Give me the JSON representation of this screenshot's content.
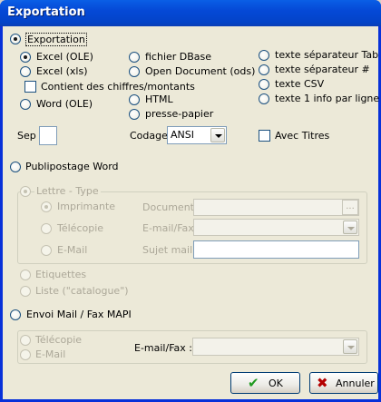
{
  "window": {
    "title": "Exportation"
  },
  "export_section": {
    "radio_label": "Exportation",
    "formats_col1": [
      "Excel (OLE)",
      "Excel (xls)"
    ],
    "contains_numbers_label": "Contient des chiffres/montants",
    "word_label": "Word (OLE)",
    "formats_col2": [
      "fichier DBase",
      "Open Document (ods)",
      "HTML",
      "presse-papier"
    ],
    "formats_col3": [
      "texte séparateur Tab",
      "texte séparateur #",
      "texte CSV",
      "texte 1 info par ligne"
    ],
    "sep_label": "Sep",
    "sep_value": "",
    "codage_label": "Codage",
    "codage_value": "ANSI",
    "avec_titres_label": "Avec Titres"
  },
  "publipostage": {
    "radio_label": "Publipostage Word",
    "lettre_type_label": "Lettre - Type",
    "sub_options": [
      "Imprimante",
      "Télécopie",
      "E-Mail"
    ],
    "document_label": "Document :",
    "email_fax_label": "E-mail/Fax :",
    "sujet_label": "Sujet mail :",
    "document_value": "",
    "email_fax_value": "",
    "sujet_value": "",
    "ellipsis": "...",
    "etiquettes_label": "Etiquettes",
    "liste_label": "Liste (\"catalogue\")"
  },
  "envoi": {
    "radio_label": "Envoi Mail / Fax  MAPI",
    "options": [
      "Télécopie",
      "E-Mail"
    ],
    "email_fax_label": "E-mail/Fax :",
    "email_fax_value": ""
  },
  "buttons": {
    "ok": "OK",
    "cancel": "Annuler"
  },
  "colors": {
    "title_bar": "#0549d6",
    "dialog_bg": "#ece9d8",
    "ok_check": "#1f9a1f",
    "cancel_x": "#b40000"
  }
}
